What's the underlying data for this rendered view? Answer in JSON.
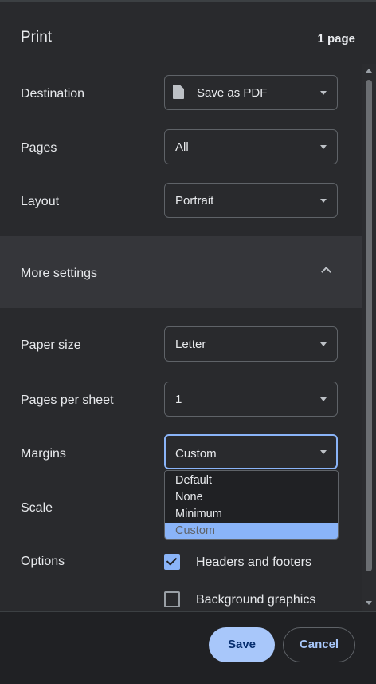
{
  "header": {
    "title": "Print",
    "page_count": "1 page"
  },
  "destination": {
    "label": "Destination",
    "value": "Save as PDF",
    "icon": "document-icon"
  },
  "pages": {
    "label": "Pages",
    "value": "All"
  },
  "layout": {
    "label": "Layout",
    "value": "Portrait"
  },
  "more_settings": {
    "label": "More settings",
    "expanded": true
  },
  "paper_size": {
    "label": "Paper size",
    "value": "Letter"
  },
  "pages_per_sheet": {
    "label": "Pages per sheet",
    "value": "1"
  },
  "margins": {
    "label": "Margins",
    "value": "Custom",
    "options": [
      "Default",
      "None",
      "Minimum",
      "Custom"
    ],
    "selected_index": 3
  },
  "scale": {
    "label": "Scale"
  },
  "options": {
    "label": "Options",
    "headers_footers": {
      "label": "Headers and footers",
      "checked": true
    },
    "background_graphics": {
      "label": "Background graphics",
      "checked": false
    }
  },
  "footer": {
    "save_label": "Save",
    "cancel_label": "Cancel"
  },
  "colors": {
    "accent": "#8ab4f8",
    "primary_button": "#a8c7fa",
    "background": "#292a2d"
  }
}
